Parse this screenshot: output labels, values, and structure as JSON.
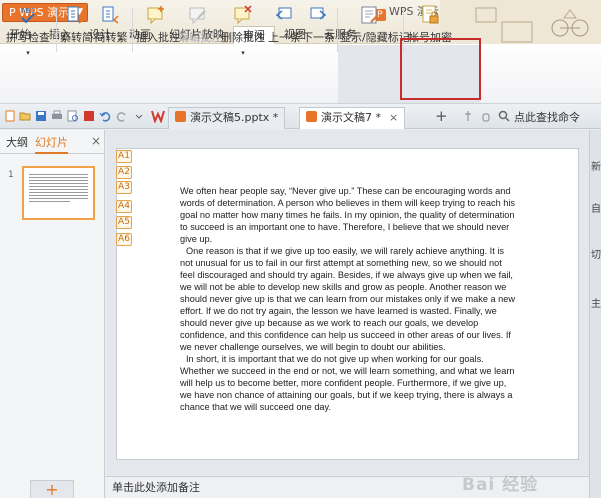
{
  "app": {
    "name": "WPS 演示",
    "window_title": "WPS 演示"
  },
  "menu": [
    "开始",
    "插入",
    "设计",
    "动画",
    "幻灯片放映",
    "审阅",
    "视图",
    "云服务"
  ],
  "menu_active": "审阅",
  "ribbon": {
    "spellcheck": "拼写检查",
    "to_simplified": "繁转简",
    "to_traditional": "简转繁",
    "insert_comment": "插入批注",
    "edit_comment": "编辑批注",
    "delete_comment": "删除批注",
    "prev": "上一条",
    "next": "下一条",
    "show_hide_markup": "显示/隐藏标记",
    "account_encrypt": "帐号加密",
    "abc": "ABC"
  },
  "tabs": [
    {
      "label": "演示文稿5.pptx *"
    },
    {
      "label": "演示文稿7 *"
    }
  ],
  "tab_close": "×",
  "add_tab": "+",
  "command_search": "点此查找命令",
  "left_pane": {
    "outline_tab": "大纲",
    "slides_tab": "幻灯片",
    "close": "×",
    "slide_number": "1",
    "add_slide": "+"
  },
  "note_tags": [
    "A1",
    "A2",
    "A3",
    "A4",
    "A5",
    "A6"
  ],
  "slide_text": [
    "We often hear people say, “Never give up.” These can be encouraging words and words of determination. A person who believes in them will keep trying to reach his goal no matter how many times he fails. In my opinion, the quality of determination to succeed is an important one to have. Therefore, I believe that we should never give up.",
    "One reason is that if we give up too easily, we will rarely achieve anything. It is not unusual for us to fail in our first attempt at something new, so we should not feel discouraged and should try again. Besides, if we always give up when we fail, we will not be able to develop new skills and grow as people. Another reason we should never give up is that we can learn from our mistakes only if we make a new effort. If we do not try again, the lesson we have learned is wasted. Finally, we should never give up because as we work to reach our goals, we develop confidence, and this confidence can help us succeed in other areas of our lives. If we never challenge ourselves, we will begin to doubt our abilities.",
    "In short, it is important that we do not give up when working for our goals. Whether we succeed in the end or not, we will learn something, and what we learn will help us to become better, more confident people. Furthermore, if we give up, we have non chance of attaining our goals, but if we keep trying, there is always a chance that we will succeed one day."
  ],
  "notes_placeholder": "单击此处添加备注",
  "right_strip": [
    "新",
    "自",
    "切",
    "主"
  ],
  "watermark": "Bai 经验",
  "colors": {
    "accent_orange": "#e8742b",
    "highlight_red": "#c72c2c"
  }
}
